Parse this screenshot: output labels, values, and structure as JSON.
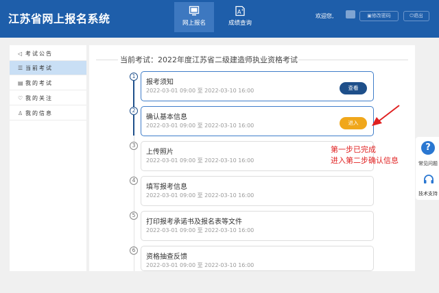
{
  "header": {
    "logo": "江苏省网上报名系统",
    "nav": [
      {
        "label": "网上报名",
        "icon": "monitor-icon"
      },
      {
        "label": "成绩查询",
        "icon": "grade-document-icon"
      }
    ],
    "welcome": "欢迎您,",
    "change_password": "修改密码",
    "logout": "退出"
  },
  "sidebar": {
    "items": [
      {
        "label": "考试公告",
        "icon": "speaker-icon"
      },
      {
        "label": "当前考试",
        "icon": "list-icon"
      },
      {
        "label": "我的考试",
        "icon": "document-icon"
      },
      {
        "label": "我的关注",
        "icon": "heart-icon"
      },
      {
        "label": "我的信息",
        "icon": "person-icon"
      }
    ]
  },
  "main": {
    "current_exam": "当前考试：2022年度江苏省二级建造师执业资格考试",
    "steps": [
      {
        "num": "1",
        "title": "报考须知",
        "time": "2022-03-01 09:00 至 2022-03-10 16:00",
        "button": "查看"
      },
      {
        "num": "2",
        "title": "确认基本信息",
        "time": "2022-03-01 09:00 至 2022-03-10 16:00",
        "button": "进入"
      },
      {
        "num": "3",
        "title": "上传照片",
        "time": "2022-03-01 09:00 至 2022-03-10 16:00"
      },
      {
        "num": "4",
        "title": "填写报考信息",
        "time": "2022-03-01 09:00 至 2022-03-10 16:00"
      },
      {
        "num": "5",
        "title": "打印报考承诺书及报名表等文件",
        "time": "2022-03-01 09:00 至 2022-03-10 16:00"
      },
      {
        "num": "6",
        "title": "资格抽查反馈",
        "time": "2022-03-01 09:00 至 2022-03-10 16:00"
      }
    ]
  },
  "annotation": {
    "line1": "第一步已完成",
    "line2": "进入第二步确认信息"
  },
  "float": {
    "faq": "常见问题",
    "support": "技术支持"
  },
  "colors": {
    "header": "#1e5eaa",
    "primary": "#1e4f8a",
    "enter_button": "#f0a71b",
    "annotation": "#e02020"
  }
}
